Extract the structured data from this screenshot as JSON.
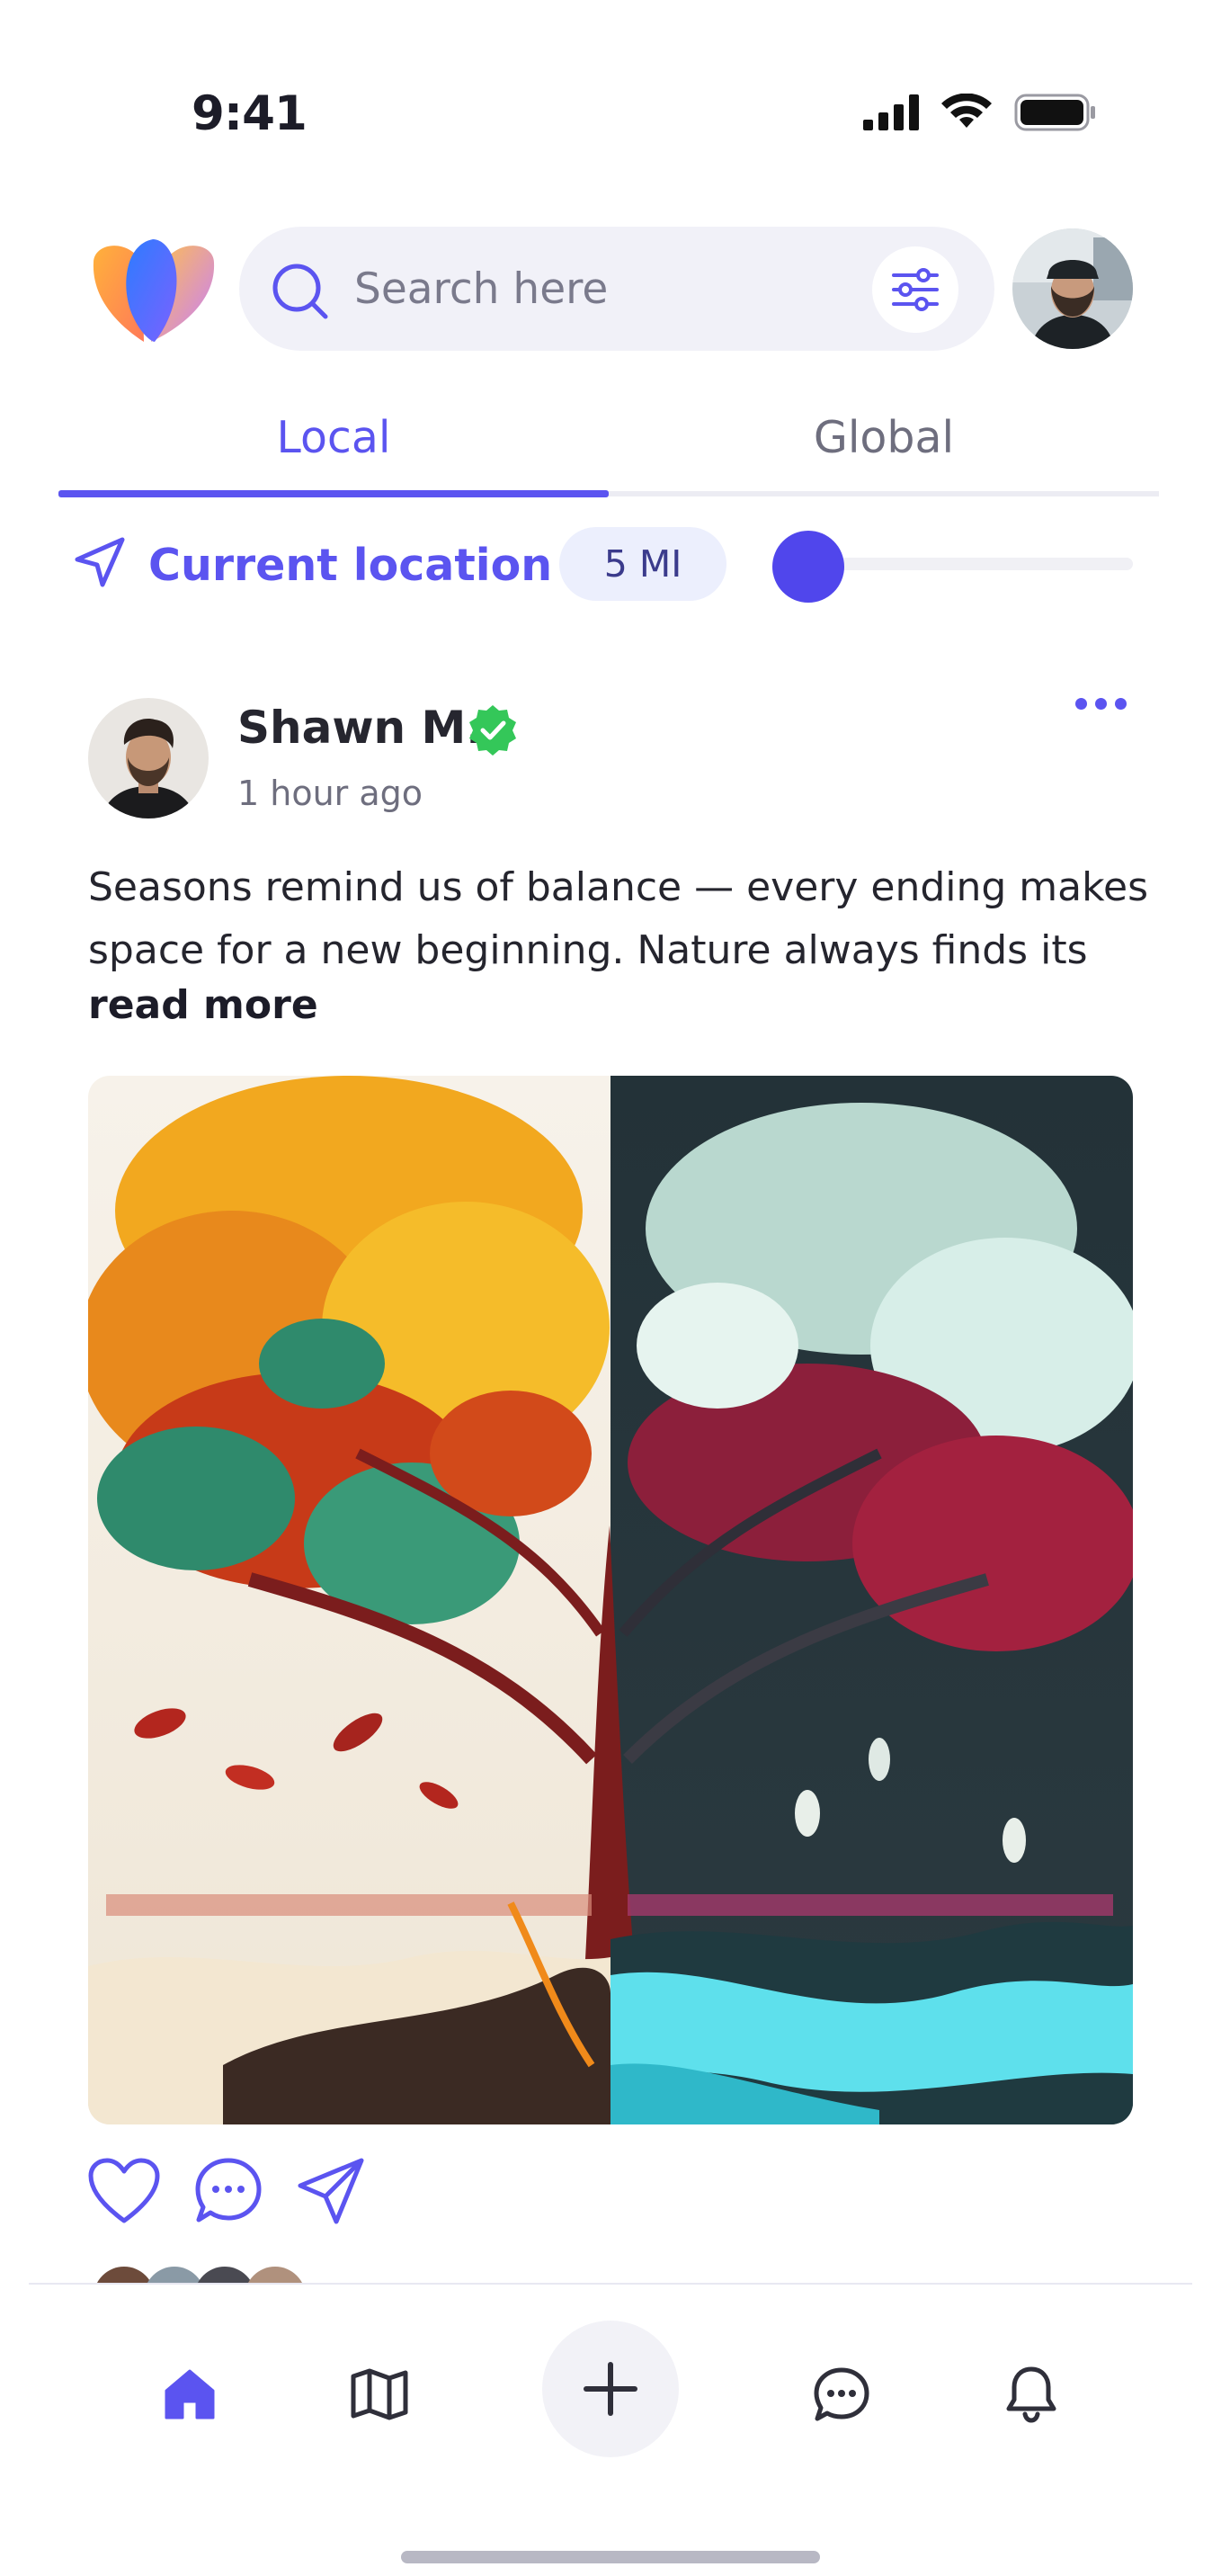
{
  "status_bar": {
    "time": "9:41"
  },
  "search": {
    "placeholder": "Search here",
    "value": ""
  },
  "tabs": [
    {
      "label": "Local",
      "active": true
    },
    {
      "label": "Global",
      "active": false
    }
  ],
  "location": {
    "label": "Current location",
    "distance": "5 MI",
    "radius_slider_fraction": 0.05
  },
  "post": {
    "author": "Shawn M.",
    "verified": true,
    "time_ago": "1 hour ago",
    "caption": "Seasons remind us of balance — every ending makes space for a new beginning. Nature always finds its",
    "read_more": "read more",
    "image_subject": "autumn and winter tree"
  },
  "actions": [
    "heart-icon",
    "comment-icon",
    "share-icon"
  ],
  "nav": {
    "items": [
      "home-icon",
      "map-icon",
      "add-icon",
      "chat-icon",
      "bell-icon"
    ],
    "active": "home-icon"
  },
  "colors": {
    "accent": "#5b54f0",
    "verified": "#34c759",
    "muted": "#6e6e7e"
  }
}
